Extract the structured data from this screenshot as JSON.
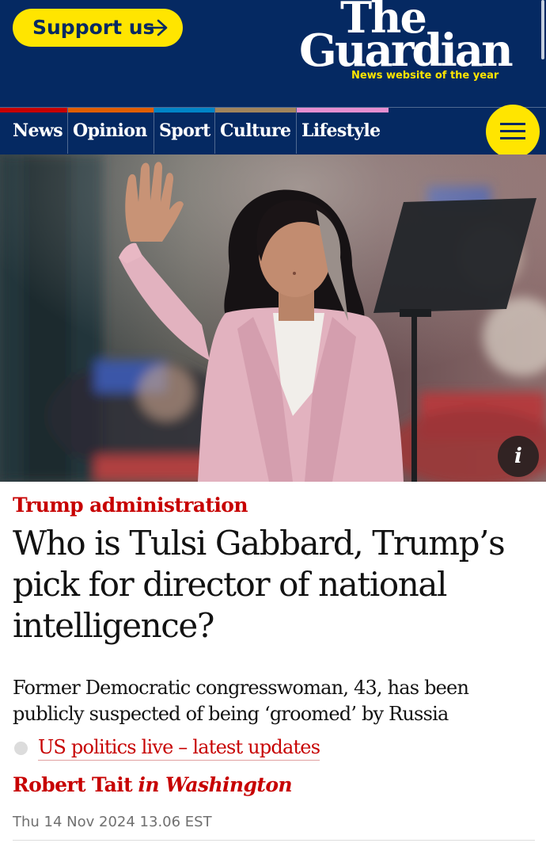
{
  "header": {
    "support_label": "Support us",
    "logo_line1": "The",
    "logo_line2": "Guardian",
    "tagline": "News website of the year",
    "background": "#052962",
    "accent": "#ffe500"
  },
  "nav": {
    "pillars": [
      {
        "label": "News",
        "color": "#c70000"
      },
      {
        "label": "Opinion",
        "color": "#e05e00"
      },
      {
        "label": "Sport",
        "color": "#0084c6"
      },
      {
        "label": "Culture",
        "color": "#a1845c"
      },
      {
        "label": "Lifestyle",
        "color": "#bb3b80"
      }
    ],
    "menu_icon": "hamburger-icon"
  },
  "hero": {
    "info_label": "i"
  },
  "article": {
    "kicker": "Trump administration",
    "headline": "Who is Tulsi Gabbard, Trump’s pick for director of national intelligence?",
    "standfirst": "Former Democratic congresswoman, 43, has been publicly suspected of being ‘groomed’ by Russia",
    "live_link": "US politics live – latest updates",
    "author": "Robert Tait",
    "location": "in Washington",
    "date": "Thu 14 Nov 2024 13.06 EST",
    "accent": "#c70000"
  }
}
